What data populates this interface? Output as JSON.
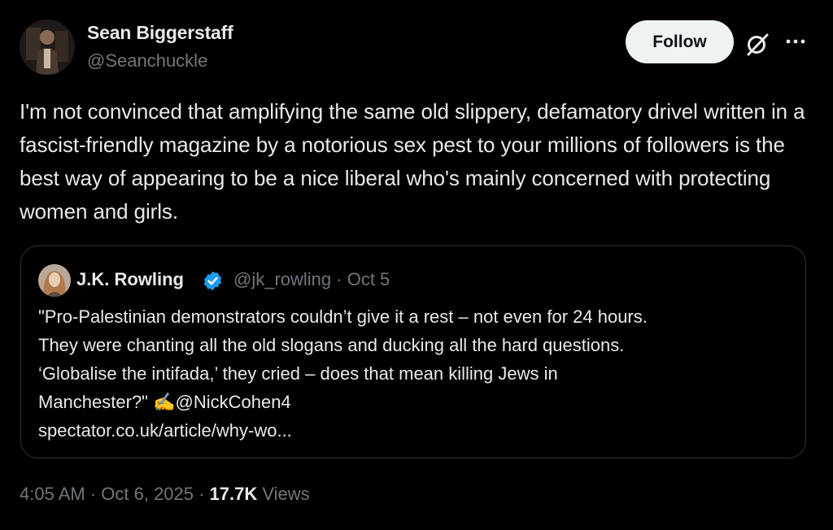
{
  "author": {
    "name": "Sean Biggerstaff",
    "handle": "@Seanchuckle",
    "avatar_icon": "user-avatar"
  },
  "actions": {
    "follow_label": "Follow",
    "grok_icon": "grok-icon",
    "more_icon": "more-icon"
  },
  "tweet": {
    "text": "I'm not convinced that amplifying the same old slippery, defamatory drivel written in a fascist-friendly magazine by a notorious sex pest to your millions of followers is the best way of appearing to be a nice liberal who's mainly concerned with protecting women and girls."
  },
  "quoted_tweet": {
    "name": "J.K. Rowling",
    "verified": true,
    "handle_date": "@jk_rowling · Oct 5",
    "lines": [
      "\"Pro-Palestinian demonstrators couldn’t give it a rest – not even for 24 hours.",
      "They were chanting all the old slogans and ducking all the hard questions.",
      "‘Globalise the intifada,’ they cried – does that mean killing Jews in",
      "Manchester?\" ✍️@NickCohen4"
    ],
    "link": "spectator.co.uk/article/why-wo..."
  },
  "meta": {
    "timestamp": "4:05 AM · Oct 6, 2025 · ",
    "views_count": "17.7K",
    "views_label": " Views"
  },
  "colors": {
    "background": "#000000",
    "text": "#e7e9ea",
    "secondary": "#71767b",
    "border": "#2f3336",
    "verified": "#1d9bf0",
    "follow_bg": "#eff3f4"
  }
}
